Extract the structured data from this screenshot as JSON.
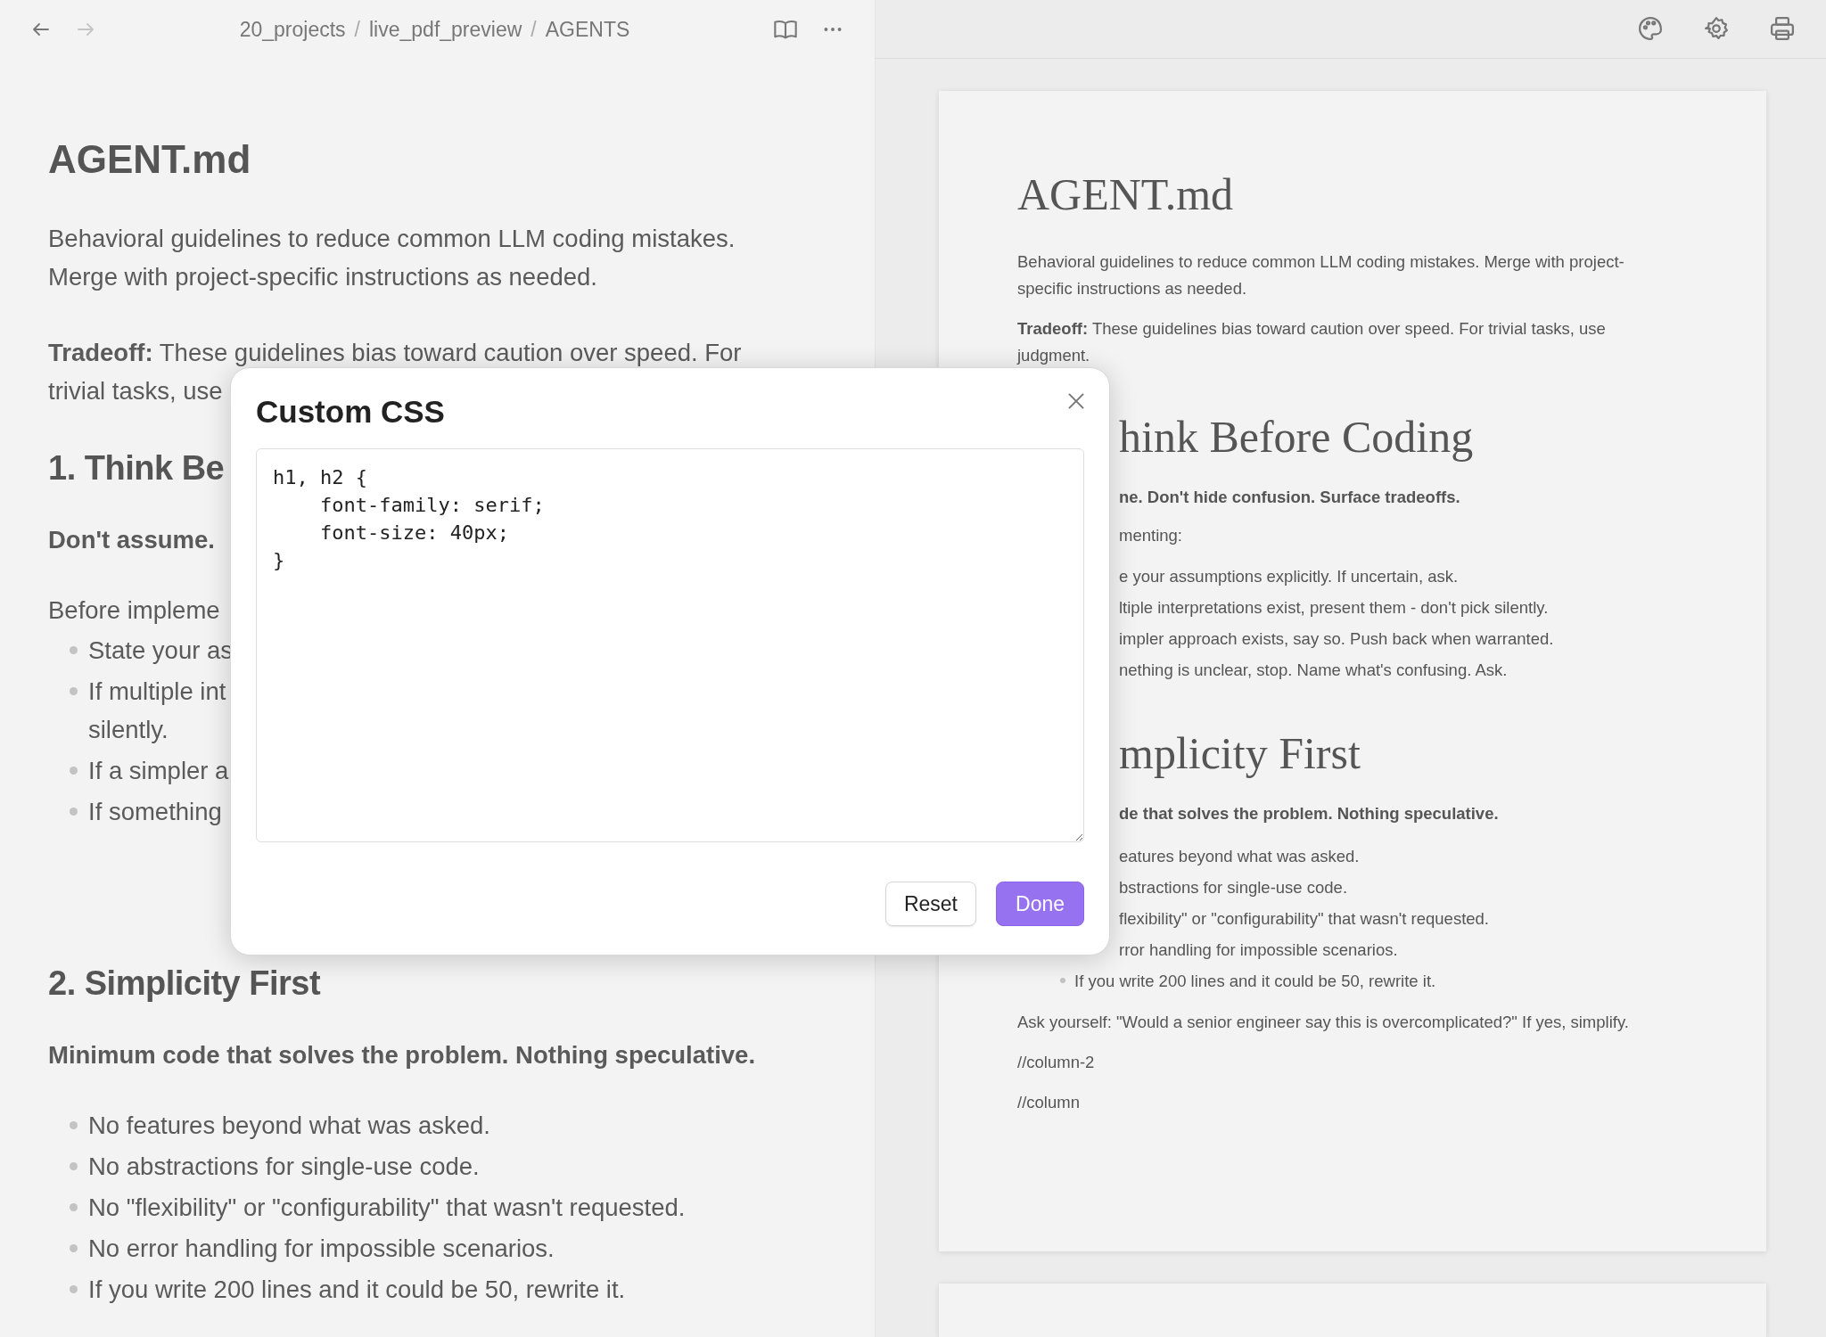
{
  "topbar": {
    "nav": [
      {
        "kind": "back",
        "disabled": false
      },
      {
        "kind": "forward",
        "disabled": true
      }
    ],
    "breadcrumb": {
      "separator": "/",
      "items": [
        "20_projects",
        "live_pdf_preview",
        "AGENTS"
      ]
    }
  },
  "editor": {
    "blocks": [
      {
        "kind": "h1",
        "text": "AGENT.md"
      },
      {
        "kind": "p",
        "text": "Behavioral guidelines to reduce common LLM coding mistakes.\nMerge with project-specific instructions as needed."
      },
      {
        "kind": "p",
        "text": "**Tradeoff:** These guidelines bias toward caution over speed. For\ntrivial tasks, use"
      },
      {
        "kind": "h2",
        "text": "1. Think Be"
      },
      {
        "kind": "strong",
        "text": "Don't assume."
      },
      {
        "kind": "lead-in",
        "text": "Before impleme"
      },
      {
        "kind": "bullets",
        "items": [
          "State your as",
          "If multiple int\nsilently.",
          "If a simpler a",
          "If something"
        ]
      },
      {
        "kind": "h2",
        "text": "2. Simplicity First"
      },
      {
        "kind": "strong",
        "text": "Minimum code that solves the problem. Nothing speculative."
      },
      {
        "kind": "bullets",
        "items": [
          "No features beyond what was asked.",
          "No abstractions for single-use code.",
          "No \"flexibility\" or \"configurability\" that wasn't requested.",
          "No error handling for impossible scenarios.",
          "If you write 200 lines and it could be 50, rewrite it."
        ]
      }
    ]
  },
  "preview": {
    "blocks": [
      {
        "kind": "h1",
        "text": "AGENT.md"
      },
      {
        "kind": "p",
        "text": "Behavioral guidelines to reduce common LLM coding mistakes. Merge with project-\nspecific instructions as needed."
      },
      {
        "kind": "p",
        "text": "**Tradeoff:** These guidelines bias toward caution over speed. For trivial tasks, use\njudgment."
      },
      {
        "kind": "h2",
        "clipped": true,
        "text": "hink Before Coding"
      },
      {
        "kind": "strong",
        "clipped": true,
        "text": "ne. Don't hide confusion. Surface tradeoffs."
      },
      {
        "kind": "lead-in",
        "clipped": true,
        "text": "menting:"
      },
      {
        "kind": "bullets",
        "items": [
          {
            "clipped": true,
            "text": "e your assumptions explicitly. If uncertain, ask."
          },
          {
            "clipped": true,
            "text": "ltiple interpretations exist, present them - don't pick silently."
          },
          {
            "clipped": true,
            "text": "impler approach exists, say so. Push back when warranted."
          },
          {
            "clipped": true,
            "text": "nething is unclear, stop. Name what's confusing. Ask."
          }
        ]
      },
      {
        "kind": "h2",
        "clipped": true,
        "text": "mplicity First"
      },
      {
        "kind": "strong",
        "clipped": true,
        "text": "de that solves the problem. Nothing speculative."
      },
      {
        "kind": "bullets",
        "items": [
          {
            "clipped": true,
            "text": "eatures beyond what was asked."
          },
          {
            "clipped": true,
            "text": "bstractions for single-use code."
          },
          {
            "clipped": true,
            "text": "flexibility\" or \"configurability\" that wasn't requested."
          },
          {
            "clipped": true,
            "text": "rror handling for impossible scenarios."
          },
          {
            "clipped": false,
            "text": "If you write 200 lines and it could be 50, rewrite it."
          }
        ]
      },
      {
        "kind": "p",
        "text": "Ask yourself: \"Would a senior engineer say this is overcomplicated?\" If yes, simplify."
      },
      {
        "kind": "p",
        "text": "//column-2"
      },
      {
        "kind": "p",
        "text": "//column"
      }
    ]
  },
  "modal": {
    "title": "Custom CSS",
    "code": "h1, h2 {\n    font-family: serif;\n    font-size: 40px;\n}",
    "buttons": [
      {
        "kind": "secondary",
        "label": "Reset"
      },
      {
        "kind": "primary",
        "label": "Done"
      }
    ]
  }
}
